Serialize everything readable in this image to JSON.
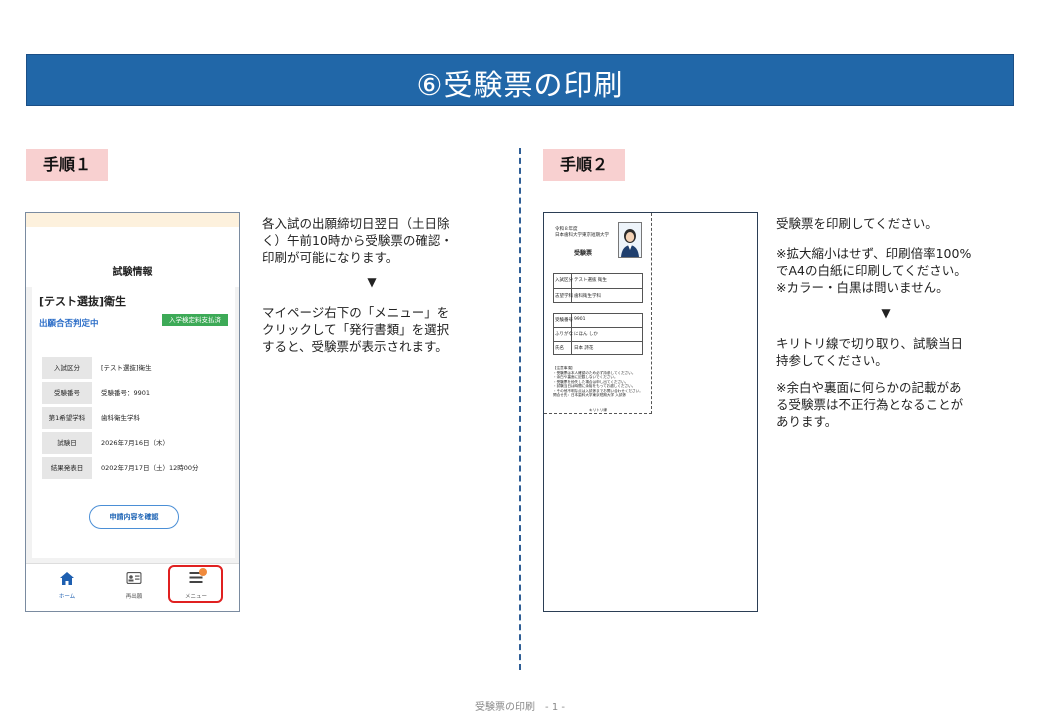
{
  "title": "⑥受験票の印刷",
  "steps": [
    {
      "label": "手順１"
    },
    {
      "label": "手順２"
    }
  ],
  "step1": {
    "para1": [
      "各入試の出願締切日翌日（土日除",
      "く）午前10時から受験票の確認・",
      "印刷が可能になります。"
    ],
    "arrow": "▼",
    "para2": [
      "マイページ右下の「メニュー」を",
      "クリックして「発行書類」を選択",
      "すると、受験票が表示されます。"
    ]
  },
  "phone": {
    "section_title": "試験情報",
    "exam_name": "[テスト選抜]衛生",
    "status": "出願合否判定中",
    "badge": "入学検定料支払済",
    "rows": [
      {
        "label": "入試区分",
        "value": "[テスト選抜]衛生"
      },
      {
        "label": "受験番号",
        "value": "受験番号：9901"
      },
      {
        "label": "第1希望学科",
        "value": "歯科衛生学科"
      },
      {
        "label": "試験日",
        "value": "2026年7月16日（木）"
      },
      {
        "label": "結果発表日",
        "value": "0202年7月17日（土）12時00分"
      }
    ],
    "confirm_button": "申請内容を確認",
    "nav": [
      {
        "label": "ホーム",
        "icon": "home-icon"
      },
      {
        "label": "再出願",
        "icon": "id-card-icon"
      },
      {
        "label": "メニュー",
        "icon": "menu-icon"
      }
    ],
    "accent_color": "#2a6cc7",
    "highlight_color": "#e02020"
  },
  "ticket": {
    "year": "令和８年度",
    "school": "日本歯科大学東京短期大学",
    "heading": "受験票",
    "rows_a": [
      {
        "label": "入試区分",
        "value": "テスト選抜 衛生"
      },
      {
        "label": "志望学科",
        "value": "歯科衛生学科"
      }
    ],
    "rows_b": [
      {
        "label": "受験番号",
        "value": "9901"
      },
      {
        "label": "ふりがな",
        "value": "にほん しか"
      },
      {
        "label": "氏名",
        "value": "日本 詩花"
      }
    ],
    "notes_title": "【注意事項】",
    "notes": [
      "・受験票は本人確認のため必ず持参してください。",
      "・余白や裏面に記載しないでください。",
      "・受験票を紛失した場合は申し出てください。",
      "・試験当日は時間に余裕をもってお越しください。",
      "・その他不明な点は入試係までお問い合わせください。",
      "問合せ先：日本歯科大学東京短期大学 入試係"
    ],
    "cut_label": "キリトリ線"
  },
  "step2": {
    "line1": "受験票を印刷してください。",
    "note1": [
      "※拡大縮小はせず、印刷倍率100%",
      "でA4の白紙に印刷してください。",
      "※カラー・白黒は問いません。"
    ],
    "arrow": "▼",
    "line2": [
      "キリトリ線で切り取り、試験当日",
      "持参してください。"
    ],
    "note2": [
      "※余白や裏面に何らかの記載があ",
      "る受験票は不正行為となることが",
      "あります。"
    ]
  },
  "footer": "受験票の印刷　- 1 -",
  "colors": {
    "banner": "#2167a8",
    "step_label_bg": "#f8d0d0",
    "divider": "#2f5e96"
  }
}
